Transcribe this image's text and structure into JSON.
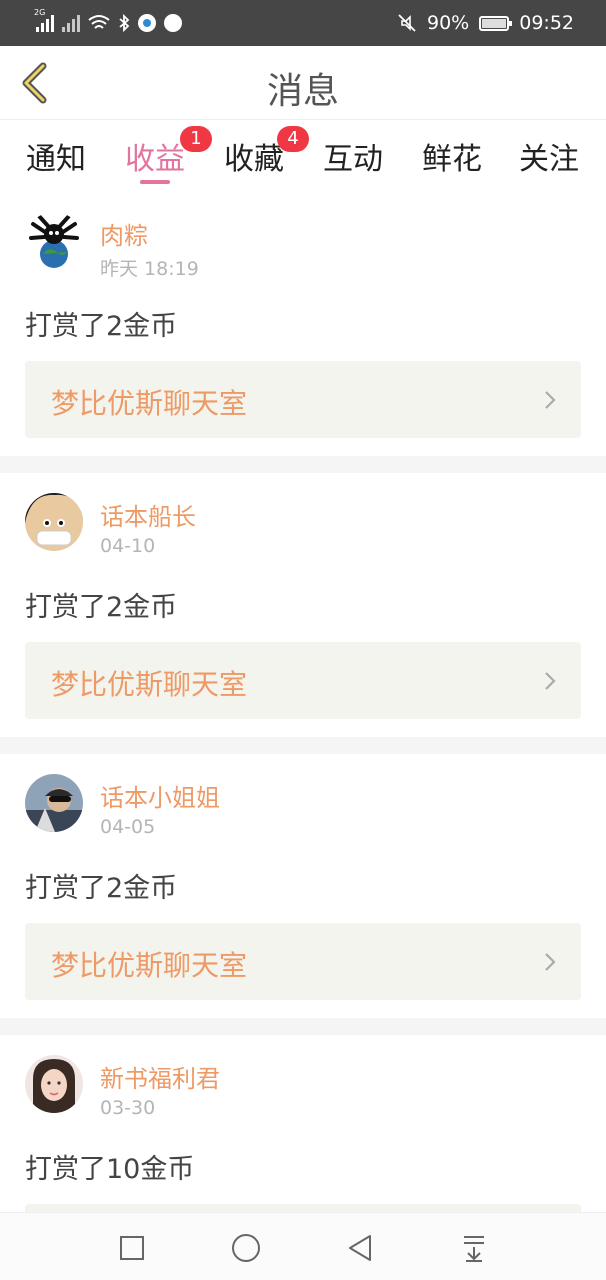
{
  "status_bar": {
    "network_label": "2G",
    "battery": "90%",
    "time": "09:52"
  },
  "header": {
    "title": "消息"
  },
  "tabs": [
    {
      "label": "通知",
      "badge": null
    },
    {
      "label": "收益",
      "badge": "1"
    },
    {
      "label": "收藏",
      "badge": "4"
    },
    {
      "label": "互动",
      "badge": null
    },
    {
      "label": "鲜花",
      "badge": null
    },
    {
      "label": "关注",
      "badge": null
    }
  ],
  "active_tab": "收益",
  "items": [
    {
      "user": "肉粽",
      "time": "昨天 18:19",
      "message": "打赏了2金币",
      "target": "梦比优斯聊天室"
    },
    {
      "user": "话本船长",
      "time": "04-10",
      "message": "打赏了2金币",
      "target": "梦比优斯聊天室"
    },
    {
      "user": "话本小姐姐",
      "time": "04-05",
      "message": "打赏了2金币",
      "target": "梦比优斯聊天室"
    },
    {
      "user": "新书福利君",
      "time": "03-30",
      "message": "打赏了10金币",
      "target": ""
    }
  ],
  "colors": {
    "accent": "#e3739f",
    "name_orange": "#ee9a66",
    "badge_red": "#ef3844",
    "status_bar": "#464646"
  }
}
